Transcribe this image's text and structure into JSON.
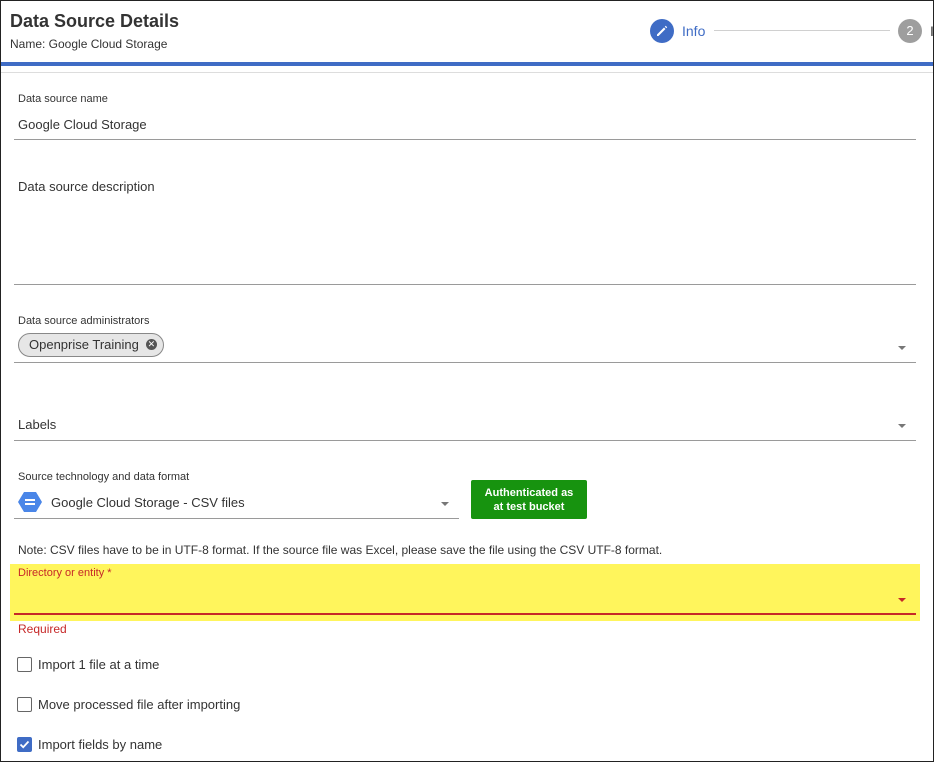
{
  "header": {
    "title": "Data Source Details",
    "subtitle": "Name: Google Cloud Storage"
  },
  "stepper": {
    "step1_label": "Info",
    "step2_number": "2",
    "step2_label": "I"
  },
  "form": {
    "name": {
      "label": "Data source name",
      "value": "Google Cloud Storage"
    },
    "description": {
      "label": "Data source description",
      "value": ""
    },
    "administrators": {
      "label": "Data source administrators",
      "chips": [
        "Openprise Training"
      ]
    },
    "labels": {
      "label": "Labels"
    },
    "source_tech": {
      "label": "Source technology and data format",
      "value": "Google Cloud Storage - CSV files",
      "icon": "google-cloud-storage-icon"
    },
    "auth_button": {
      "line1": "Authenticated as",
      "line2": "at test bucket",
      "color": "#17930f"
    },
    "note": "Note: CSV files have to be in UTF-8 format. If the source file was Excel, please save the file using the CSV UTF-8 format.",
    "directory": {
      "label": "Directory or entity *",
      "error": "Required",
      "value": ""
    },
    "checkboxes": [
      {
        "label": "Import 1 file at a time",
        "checked": false
      },
      {
        "label": "Move processed file after importing",
        "checked": false
      },
      {
        "label": "Import fields by name",
        "checked": true
      }
    ]
  },
  "colors": {
    "accent": "#3f6cc5",
    "error": "#c62828",
    "highlight": "#fff55c"
  }
}
